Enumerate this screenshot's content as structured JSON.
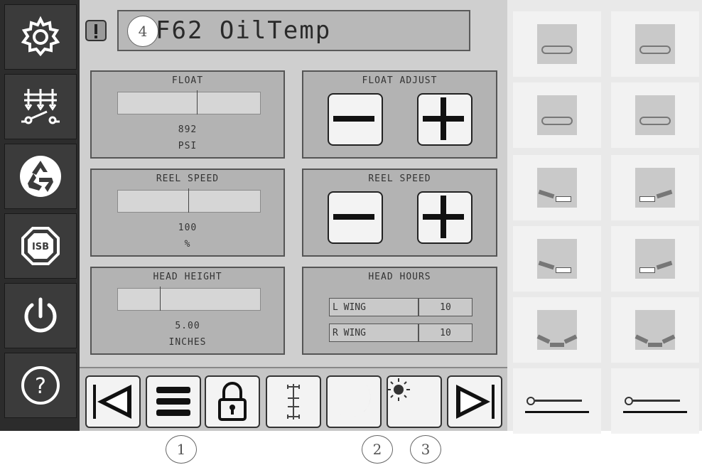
{
  "header": {
    "alarm_icon": "alarm-icon",
    "code_title": "F62 OilTemp"
  },
  "sidebar": {
    "items": [
      {
        "name": "settings",
        "icon": "gear-icon"
      },
      {
        "name": "header-controls",
        "icon": "header-controls-icon"
      },
      {
        "name": "recycle",
        "icon": "recycle-icon"
      },
      {
        "name": "isb",
        "icon": "isb-icon",
        "label": "ISB"
      },
      {
        "name": "power",
        "icon": "power-icon"
      },
      {
        "name": "help",
        "icon": "help-icon",
        "label": "?"
      }
    ]
  },
  "float": {
    "title": "FLOAT",
    "value": "892",
    "unit": "PSI"
  },
  "float_adjust": {
    "title": "FLOAT ADJUST"
  },
  "reel_speed": {
    "title": "REEL SPEED",
    "value": "100",
    "unit": "%"
  },
  "reel_speed_adjust": {
    "title": "REEL SPEED"
  },
  "head_height": {
    "title": "HEAD HEIGHT",
    "value": "5.00",
    "unit": "INCHES"
  },
  "head_hours": {
    "title": "HEAD HOURS",
    "rows": [
      {
        "label": "L WING",
        "value": "10"
      },
      {
        "label": "R WING",
        "value": "10"
      }
    ]
  },
  "toolbar": {
    "buttons": [
      "previous-page",
      "menu",
      "lock",
      "header-layout",
      "night-mode",
      "day-mode",
      "next-page"
    ]
  },
  "right_grid": {
    "buttons": [
      "reel-fore-aft-icon",
      "reel-aft-icon",
      "reel-forward-icon",
      "reel-back-icon",
      "left-wing-up-icon",
      "right-wing-up-icon",
      "left-wing-down-icon",
      "right-wing-down-icon",
      "wings-up-icon",
      "wings-down-icon",
      "header-tilt-up-icon",
      "header-tilt-down-icon"
    ]
  },
  "callouts": [
    "1",
    "2",
    "3",
    "4"
  ],
  "colors": {
    "sidebar": "#2c2c2c",
    "panel": "#cfcfcf",
    "card": "#b3b3b3",
    "button": "#f3f3f3"
  }
}
